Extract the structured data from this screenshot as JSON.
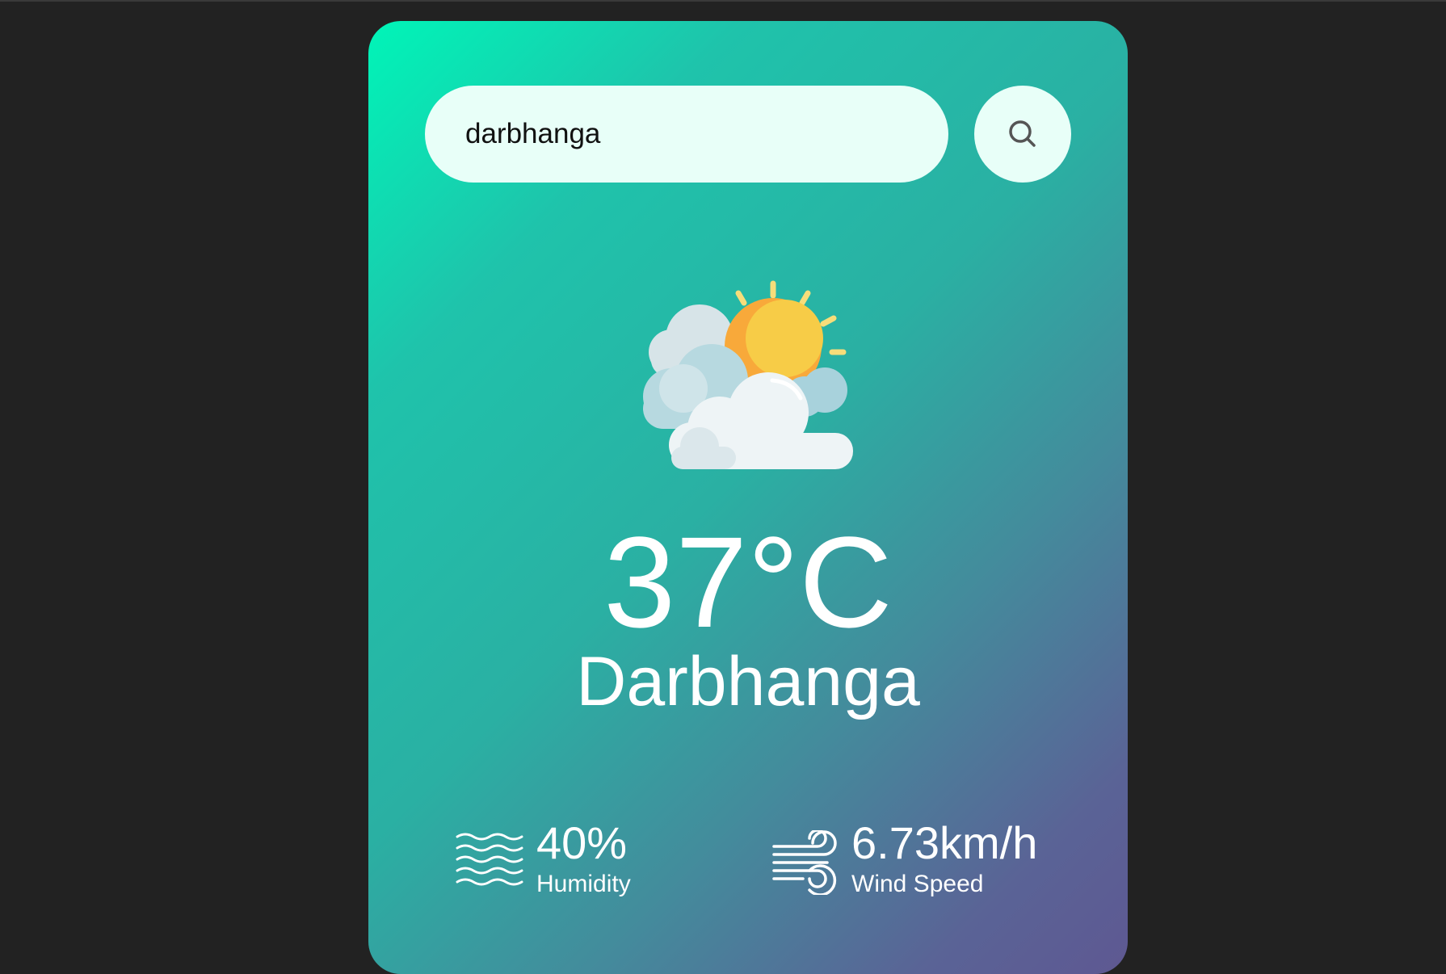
{
  "search": {
    "value": "darbhanga",
    "button_icon": "search-icon"
  },
  "weather": {
    "icon": "sun-behind-clouds-icon",
    "temperature": "37°C",
    "city": "Darbhanga"
  },
  "humidity": {
    "icon": "humidity-waves-icon",
    "value": "40%",
    "label": "Humidity"
  },
  "wind": {
    "icon": "wind-icon",
    "value": "6.73km/h",
    "label": "Wind Speed"
  },
  "colors": {
    "page_background": "#222222",
    "card_gradient_start": "#00f5b8",
    "card_gradient_end": "#5e5892",
    "input_background": "#e8fff8",
    "text": "#ffffff"
  }
}
